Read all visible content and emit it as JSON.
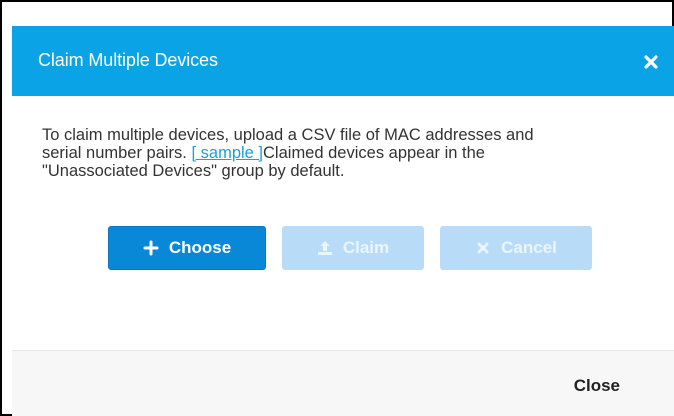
{
  "dialog": {
    "title": "Claim Multiple Devices",
    "message_line1": "To claim multiple devices, upload a CSV file of MAC addresses and",
    "message_line2_prefix": "serial number pairs. ",
    "sample_link": "[ sample ]",
    "message_line2_suffix": "Claimed devices appear in the",
    "message_line3": "\"Unassociated Devices\" group by default."
  },
  "buttons": {
    "choose": "Choose",
    "claim": "Claim",
    "cancel": "Cancel"
  },
  "footer": {
    "close": "Close"
  },
  "colors": {
    "header": "#0aa4e6",
    "primary": "#0a88d8",
    "disabled": "#b8dcf7",
    "link": "#1a9fe0"
  },
  "icons": {
    "header_close": "close-icon",
    "choose": "plus-icon",
    "claim": "upload-icon",
    "cancel": "x-icon"
  }
}
